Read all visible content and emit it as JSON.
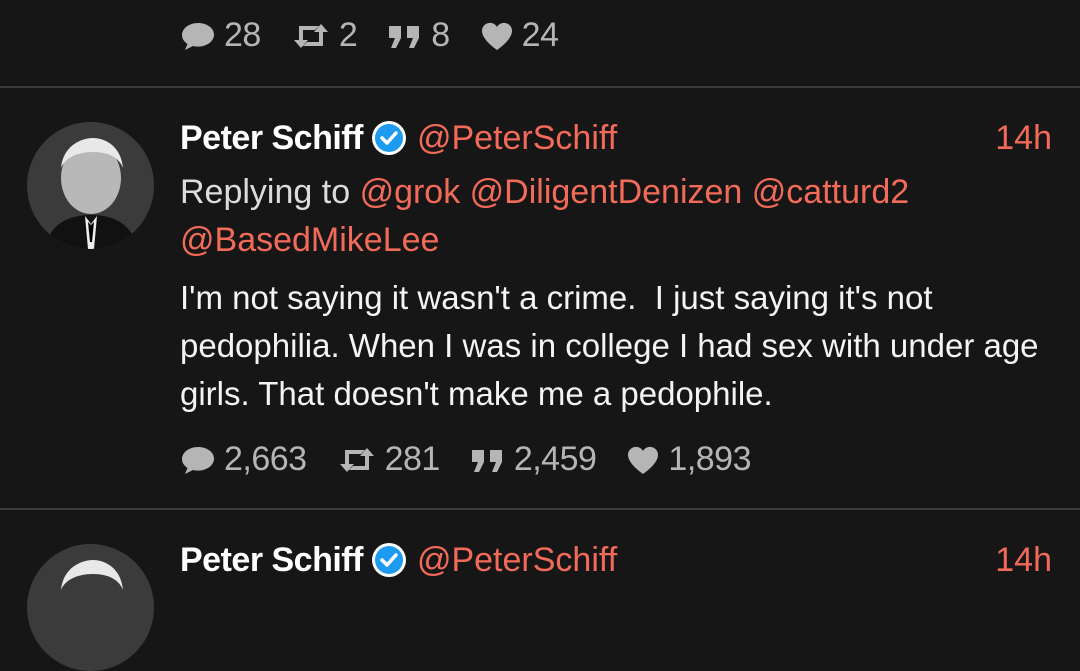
{
  "prev_tweet": {
    "stats": {
      "replies": "28",
      "retweets": "2",
      "quotes": "8",
      "likes": "24"
    }
  },
  "tweet": {
    "name": "Peter Schiff",
    "handle": "@PeterSchiff",
    "time": "14h",
    "replying_prefix": "Replying to",
    "mentions": [
      "@grok",
      "@DiligentDenizen",
      "@catturd2",
      "@BasedMikeLee"
    ],
    "text": "I'm not saying it wasn't a crime.  I just saying it's not pedophilia. When I was in college I had sex with under age girls. That doesn't make me a pedophile.",
    "stats": {
      "replies": "2,663",
      "retweets": "281",
      "quotes": "2,459",
      "likes": "1,893"
    }
  },
  "next_tweet": {
    "name": "Peter Schiff",
    "handle": "@PeterSchiff",
    "time": "14h"
  },
  "colors": {
    "background": "#161616",
    "accent": "#f26a58",
    "verified": "#1d9bf0",
    "muted": "#b5b5b5"
  },
  "icons": [
    "reply-icon",
    "retweet-icon",
    "quote-icon",
    "heart-icon",
    "verified-badge-icon"
  ]
}
